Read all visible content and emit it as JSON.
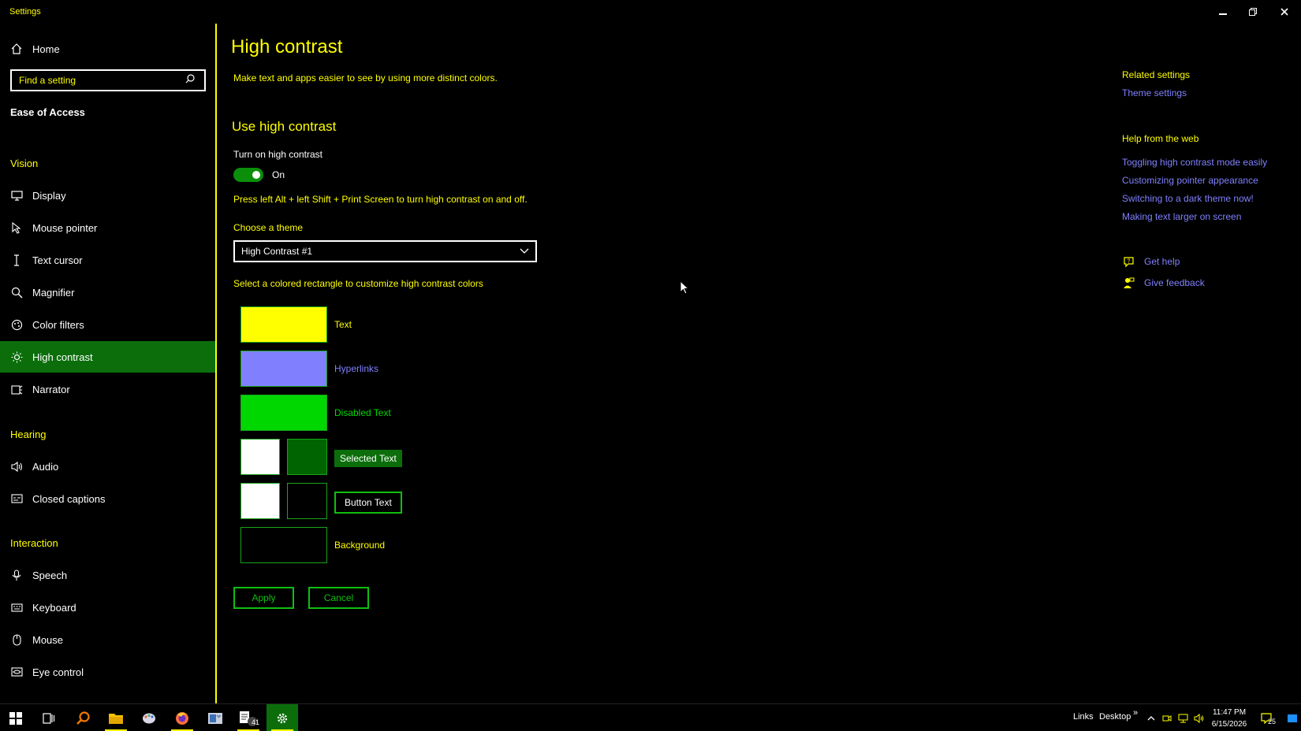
{
  "window": {
    "title": "Settings"
  },
  "sidebar": {
    "home_label": "Home",
    "search_placeholder": "Find a setting",
    "section_title": "Ease of Access",
    "groups": {
      "vision": "Vision",
      "hearing": "Hearing",
      "interaction": "Interaction"
    },
    "items": [
      {
        "label": "Display",
        "icon": "display-icon"
      },
      {
        "label": "Mouse pointer",
        "icon": "mouse-pointer-icon"
      },
      {
        "label": "Text cursor",
        "icon": "text-cursor-icon"
      },
      {
        "label": "Magnifier",
        "icon": "magnifier-icon"
      },
      {
        "label": "Color filters",
        "icon": "color-filters-icon"
      },
      {
        "label": "High contrast",
        "icon": "high-contrast-icon",
        "active": true
      },
      {
        "label": "Narrator",
        "icon": "narrator-icon"
      },
      {
        "label": "Audio",
        "icon": "audio-icon"
      },
      {
        "label": "Closed captions",
        "icon": "closed-captions-icon"
      },
      {
        "label": "Speech",
        "icon": "speech-icon"
      },
      {
        "label": "Keyboard",
        "icon": "keyboard-icon"
      },
      {
        "label": "Mouse",
        "icon": "mouse-icon"
      },
      {
        "label": "Eye control",
        "icon": "eye-control-icon"
      }
    ]
  },
  "main": {
    "title": "High contrast",
    "description": "Make text and apps easier to see by using more distinct colors.",
    "subheading": "Use high contrast",
    "toggle_label": "Turn on high contrast",
    "toggle_state": "On",
    "toggle_on": true,
    "shortcut_text": "Press left Alt + left Shift + Print Screen to turn high contrast on and off.",
    "theme_label": "Choose a theme",
    "theme_value": "High Contrast #1",
    "colors_hint": "Select a colored rectangle to customize high contrast colors",
    "swatches": {
      "text": "Text",
      "hyperlinks": "Hyperlinks",
      "disabled_text": "Disabled Text",
      "selected_text": "Selected Text",
      "button_text": "Button Text",
      "background": "Background"
    },
    "apply_label": "Apply",
    "cancel_label": "Cancel"
  },
  "colors": {
    "text": "#ffff00",
    "hyperlinks": "#8080ff",
    "disabled_text": "#00d700",
    "selected_bg": "#006400",
    "button_bg": "#000000",
    "background": "#000000",
    "accent": "#0b6e0b"
  },
  "related": {
    "heading": "Related settings",
    "theme_settings": "Theme settings",
    "web_heading": "Help from the web",
    "web_links": [
      "Toggling high contrast mode easily",
      "Customizing pointer appearance",
      "Switching to a dark theme now!",
      "Making text larger on screen"
    ],
    "get_help": "Get help",
    "give_feedback": "Give feedback"
  },
  "taskbar": {
    "links_label": "Links",
    "desktop_label": "Desktop",
    "time": "11:47 PM",
    "date": "6/15/2026",
    "notification_count": "25",
    "app_badge": "41"
  }
}
